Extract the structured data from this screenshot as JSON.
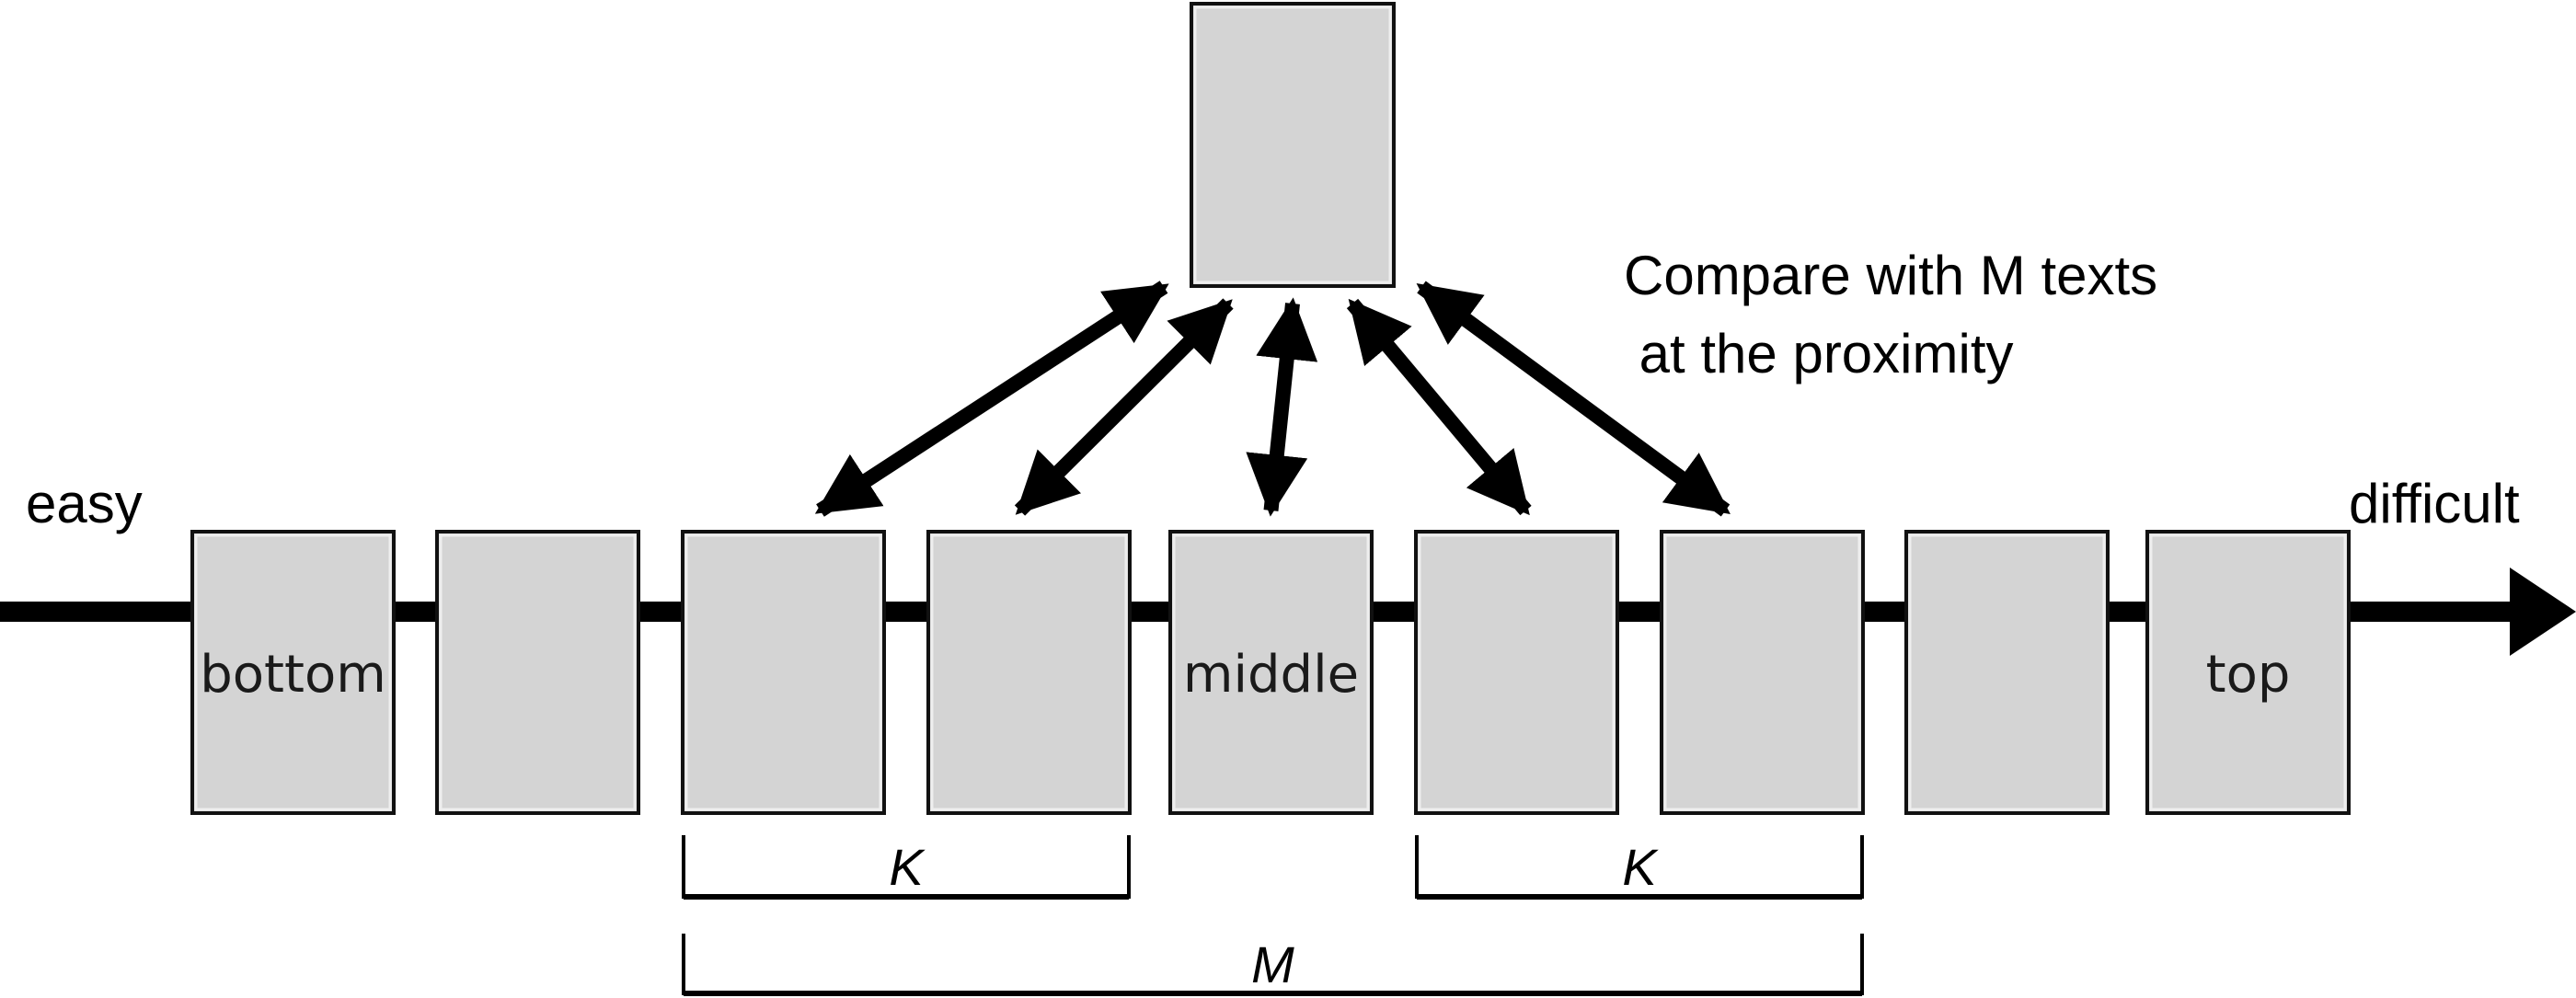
{
  "axis": {
    "start_label": "easy",
    "end_label": "difficult"
  },
  "query_box": {
    "label": ""
  },
  "ranked_texts": [
    {
      "label": "bottom"
    },
    {
      "label": ""
    },
    {
      "label": ""
    },
    {
      "label": ""
    },
    {
      "label": "middle"
    },
    {
      "label": ""
    },
    {
      "label": ""
    },
    {
      "label": ""
    },
    {
      "label": "top"
    }
  ],
  "comparison_note": {
    "line1": "Compare with M texts",
    "line2": " at the proximity"
  },
  "brackets": [
    {
      "label": "K",
      "from_index": 2,
      "to_index": 3
    },
    {
      "label": "K",
      "from_index": 5,
      "to_index": 6
    },
    {
      "label": "M",
      "from_index": 2,
      "to_index": 6
    }
  ],
  "arrows_to_indices": [
    2,
    3,
    4,
    5,
    6
  ],
  "colors": {
    "box_fill": "#d4d4d4",
    "stroke": "#000000",
    "background": "#ffffff"
  }
}
